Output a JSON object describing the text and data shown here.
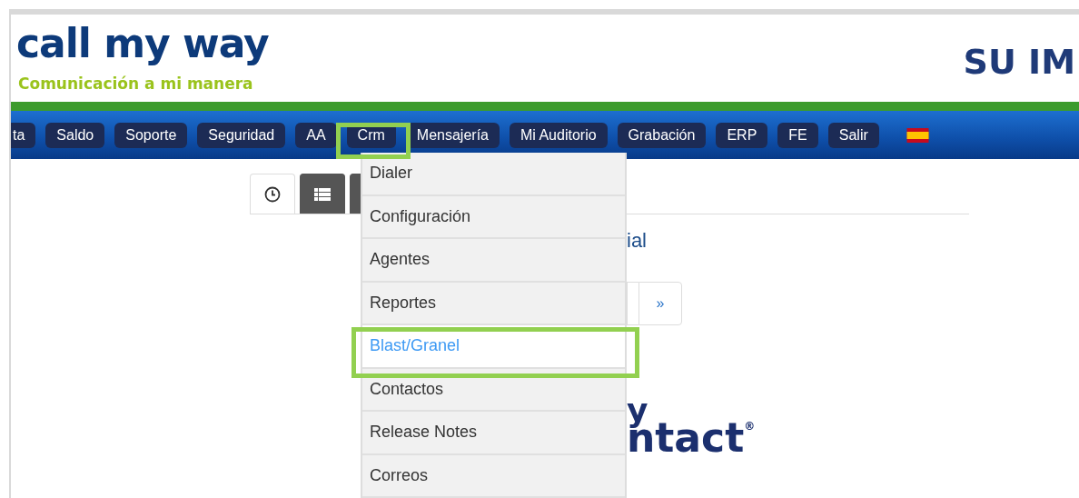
{
  "header": {
    "logo": "call my way",
    "tagline": "Comunicación a mi manera",
    "banner": "SU IM"
  },
  "nav": [
    {
      "label": "ta",
      "highlighted": false,
      "cut": true
    },
    {
      "label": "Saldo",
      "highlighted": false,
      "cut": false
    },
    {
      "label": "Soporte",
      "highlighted": false,
      "cut": false
    },
    {
      "label": "Seguridad",
      "highlighted": false,
      "cut": false
    },
    {
      "label": "AA",
      "highlighted": false,
      "cut": false
    },
    {
      "label": "Crm",
      "highlighted": true,
      "cut": false
    },
    {
      "label": "Mensajería",
      "highlighted": false,
      "cut": false
    },
    {
      "label": "Mi Auditorio",
      "highlighted": false,
      "cut": false
    },
    {
      "label": "Grabación",
      "highlighted": false,
      "cut": false
    },
    {
      "label": "ERP",
      "highlighted": false,
      "cut": false
    },
    {
      "label": "FE",
      "highlighted": false,
      "cut": false
    },
    {
      "label": "Salir",
      "highlighted": false,
      "cut": false
    }
  ],
  "tabs": [
    {
      "kind": "clock",
      "selected": true
    },
    {
      "kind": "list",
      "selected": false
    },
    {
      "kind": "other",
      "selected": false
    }
  ],
  "heading": "ial",
  "pagination": {
    "next": "»"
  },
  "brand": {
    "line1": "y",
    "line2": "ntact",
    "mark": "®"
  },
  "dropdown": [
    {
      "label": "Dialer",
      "selected": false,
      "highlighted": false
    },
    {
      "label": "Configuración",
      "selected": false,
      "highlighted": false
    },
    {
      "label": "Agentes",
      "selected": false,
      "highlighted": false
    },
    {
      "label": "Reportes",
      "selected": false,
      "highlighted": false
    },
    {
      "label": "Blast/Granel",
      "selected": true,
      "highlighted": true
    },
    {
      "label": "Contactos",
      "selected": false,
      "highlighted": false
    },
    {
      "label": "Release Notes",
      "selected": false,
      "highlighted": false
    },
    {
      "label": "Correos",
      "selected": false,
      "highlighted": false
    }
  ]
}
